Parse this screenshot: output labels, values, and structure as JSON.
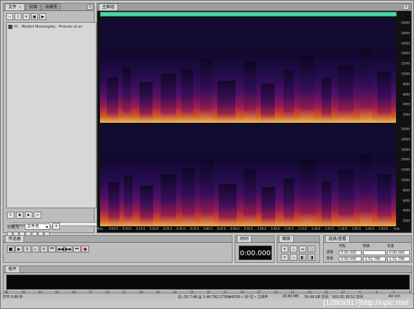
{
  "left_tabs": [
    "文件",
    "效果",
    "收藏夹"
  ],
  "main_tab": "主群组",
  "file_item": "01 - Modest Mussorgsky - Pictures at an",
  "sort_label": "分类为",
  "sort_value": "文件名",
  "timeline_labels": [
    "hms",
    "0:05.0",
    "0:10.0",
    "0:15.0",
    "0:20.0",
    "0:25.0",
    "0:30.0",
    "0:35.0",
    "0:40.0",
    "0:45.0",
    "0:50.0",
    "0:55.0",
    "1:00.0",
    "1:05.0",
    "1:10.0",
    "1:15.0",
    "1:20.0",
    "1:25.0",
    "1:30.0",
    "1:35.0",
    "1:40.0",
    "1:45.0",
    "hms"
  ],
  "freq_labels": [
    "20000",
    "18000",
    "16000",
    "14000",
    "12000",
    "10000",
    "8000",
    "6000",
    "4000",
    "2000"
  ],
  "transport_tab": "传送器",
  "time_tab": "时间",
  "time_display": "0:00.000",
  "zoom_tab": "缩放",
  "selection_tab": "选择/查看",
  "selection_headers": [
    "开始",
    "结束",
    "长度"
  ],
  "selection_rows": [
    {
      "label": "选择",
      "start": "0:00.000",
      "end": "",
      "length": "0:00.000"
    },
    {
      "label": "查看",
      "start": "0:00.000",
      "end": "1:51.786",
      "length": "1:51.786"
    }
  ],
  "levels_tab": "电平",
  "db_ticks": [
    "dB",
    "-69",
    "-66",
    "-63",
    "-60",
    "-57",
    "-54",
    "-51",
    "-48",
    "-45",
    "-42",
    "-39",
    "-36",
    "-33",
    "-30",
    "-27",
    "-24",
    "-21",
    "-18",
    "-15",
    "-12",
    "-9",
    "-6",
    "-3",
    "0"
  ],
  "status": {
    "left": "打开 0.88 秒",
    "position": "右:-30.7 dB @ 1:46.792,273Hz",
    "format": "44100 • 16 位 • 立体声",
    "size": "18.80 MB",
    "free": "59.49 GB 空闲",
    "time": "100:35:38.52 空闲",
    "shortcut": "Alt Ctrl"
  },
  "watermark": "[1280x917]http://upic.me/",
  "colors": {
    "accent": "#49d7a1",
    "spectrum_bg": "#120a31",
    "recording": "#c90000"
  }
}
